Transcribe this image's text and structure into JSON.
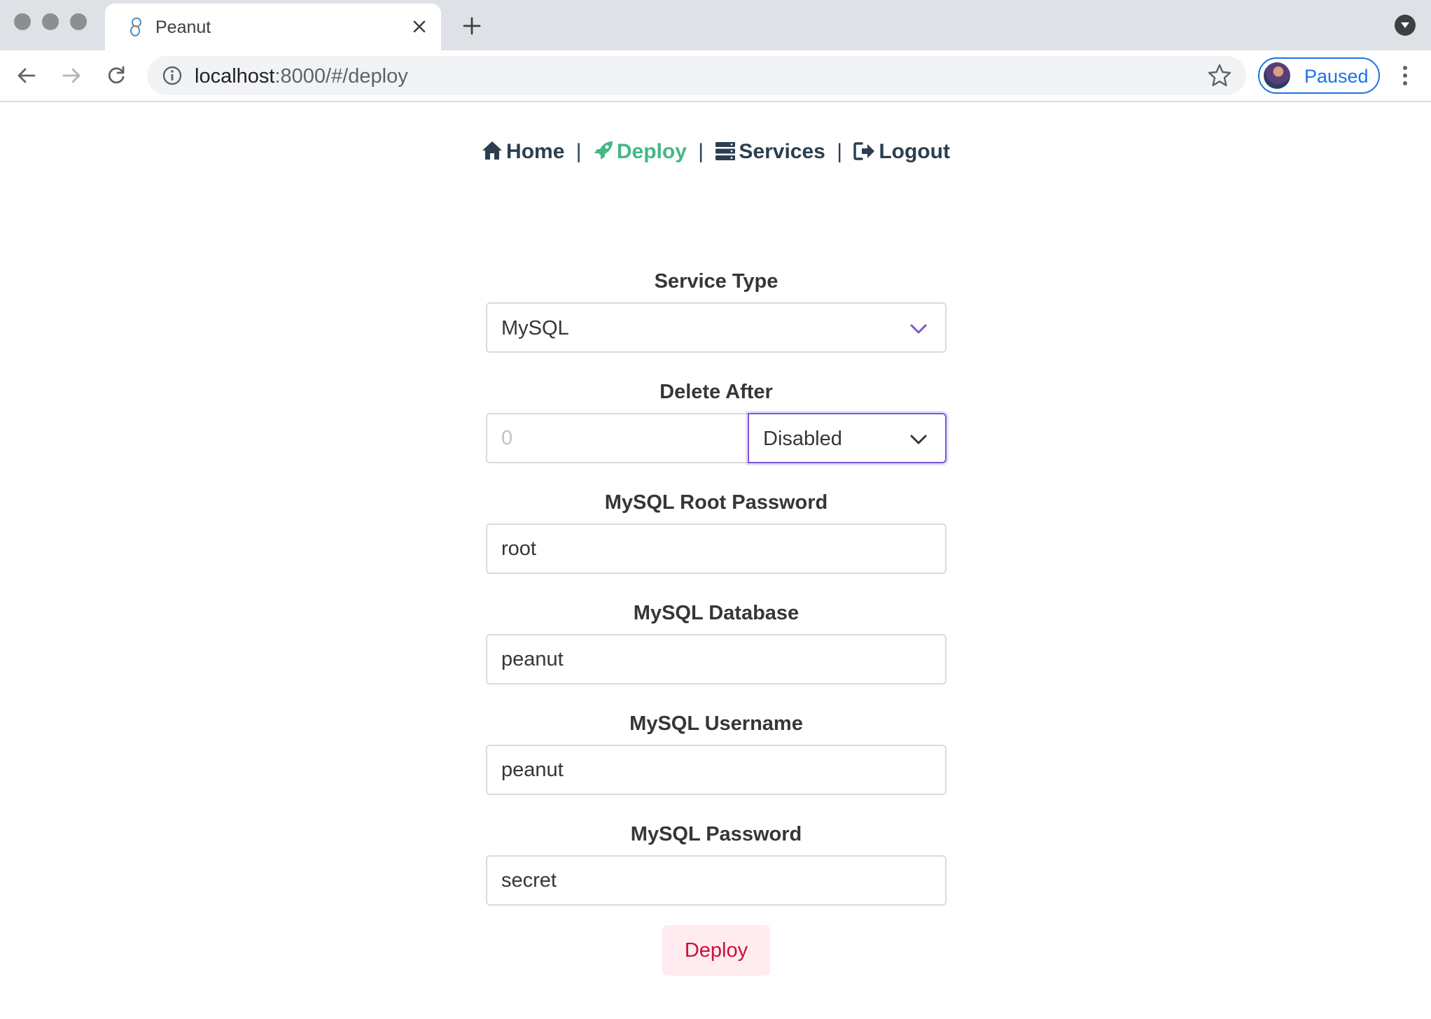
{
  "browser": {
    "tab_title": "Peanut",
    "url_host": "localhost",
    "url_rest": ":8000/#/deploy",
    "profile_label": "Paused"
  },
  "nav": {
    "home": "Home",
    "deploy": "Deploy",
    "services": "Services",
    "logout": "Logout",
    "separator": "|",
    "active_color": "#42b983"
  },
  "form": {
    "service_type_label": "Service Type",
    "service_type_value": "MySQL",
    "delete_after_label": "Delete After",
    "delete_after_placeholder": "0",
    "delete_after_unit": "Disabled",
    "root_password_label": "MySQL Root Password",
    "root_password_value": "root",
    "database_label": "MySQL Database",
    "database_value": "peanut",
    "username_label": "MySQL Username",
    "username_value": "peanut",
    "password_label": "MySQL Password",
    "password_value": "secret",
    "submit_label": "Deploy"
  }
}
